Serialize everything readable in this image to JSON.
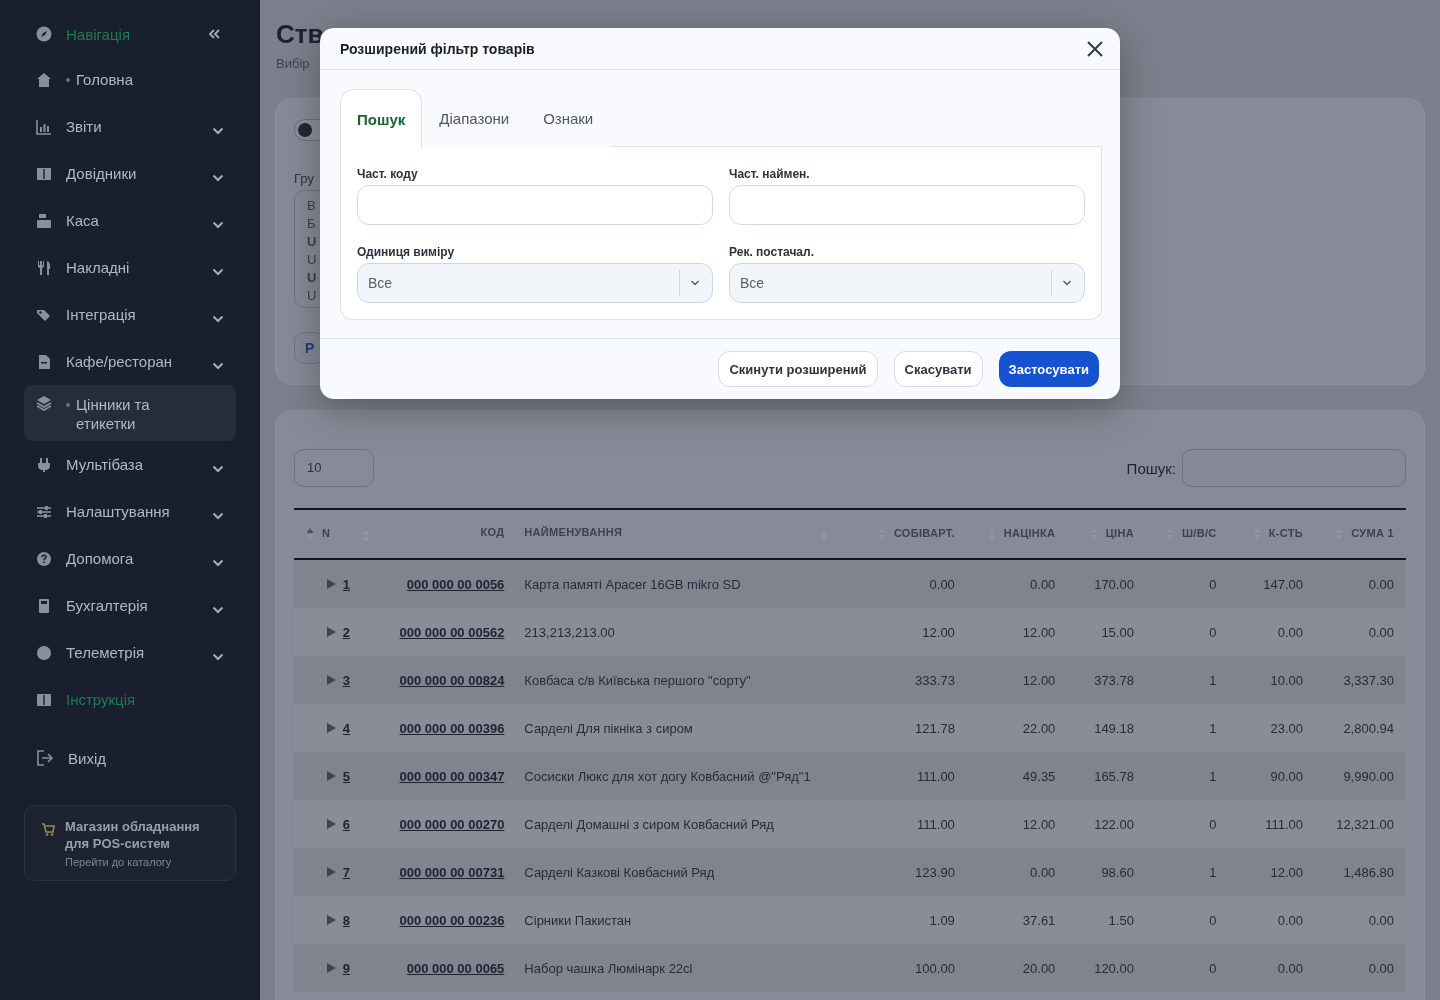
{
  "sidebar": {
    "header": {
      "label": "Навігація"
    },
    "items": [
      {
        "label": "Головна",
        "kind": "link",
        "dot": true,
        "selected": false
      },
      {
        "label": "Звіти",
        "kind": "group",
        "dot": false,
        "selected": false
      },
      {
        "label": "Довідники",
        "kind": "group",
        "dot": false,
        "selected": false
      },
      {
        "label": "Каса",
        "kind": "group",
        "dot": false,
        "selected": false
      },
      {
        "label": "Накладні",
        "kind": "group",
        "dot": false,
        "selected": false
      },
      {
        "label": "Інтеграція",
        "kind": "group",
        "dot": false,
        "selected": false
      },
      {
        "label": "Кафе/ресторан",
        "kind": "group",
        "dot": false,
        "selected": false
      },
      {
        "label": "Цінники та етикетки",
        "kind": "link",
        "dot": true,
        "selected": true
      },
      {
        "label": "Мультібаза",
        "kind": "group",
        "dot": false,
        "selected": false
      },
      {
        "label": "Налаштування",
        "kind": "group",
        "dot": false,
        "selected": false
      },
      {
        "label": "Допомога",
        "kind": "group",
        "dot": false,
        "selected": false
      },
      {
        "label": "Бухгалтерія",
        "kind": "group",
        "dot": false,
        "selected": false
      },
      {
        "label": "Телеметрія",
        "kind": "group",
        "dot": false,
        "selected": false
      },
      {
        "label": "Інструкція",
        "kind": "accent",
        "dot": false,
        "selected": false
      }
    ],
    "logout": {
      "label": "Вихід"
    },
    "promo": {
      "title": "Магазин обладнання для POS-систем",
      "link": "Перейти до каталогу"
    }
  },
  "page": {
    "title": "Ств",
    "subtitle": "Вибір",
    "filter_card": {
      "toggle": {
        "on": false
      },
      "group_label": "Гру",
      "group_list": [
        {
          "text": "В",
          "bold": false
        },
        {
          "text": "Б",
          "bold": false
        },
        {
          "text": "U",
          "bold": true
        },
        {
          "text": "U",
          "bold": false
        },
        {
          "text": "U",
          "bold": true
        },
        {
          "text": "U",
          "bold": false
        }
      ],
      "button": "Р"
    }
  },
  "table_card": {
    "page_length": "10",
    "search_label": "Пошук:",
    "columns": [
      {
        "label": "N",
        "sorted": true
      },
      {
        "label": "КОД",
        "sorted": false
      },
      {
        "label": "НАЙМЕНУВАННЯ",
        "sorted": false
      },
      {
        "label": "СОБІВАРТ.",
        "sorted": false
      },
      {
        "label": "НАЦІНКА",
        "sorted": false
      },
      {
        "label": "ЦІНА",
        "sorted": false
      },
      {
        "label": "Ш/В/С",
        "sorted": false
      },
      {
        "label": "К-СТЬ",
        "sorted": false
      },
      {
        "label": "СУМА 1",
        "sorted": false
      }
    ],
    "rows": [
      [
        "1",
        "000 000 00 0056",
        "Карта памяті Apacer 16GB mikro SD",
        "0.00",
        "0.00",
        "170.00",
        "0",
        "147.00",
        "0.00"
      ],
      [
        "2",
        "000 000 00 00562",
        "213,213,213.00",
        "12.00",
        "12.00",
        "15.00",
        "0",
        "0.00",
        "0.00"
      ],
      [
        "3",
        "000 000 00 00824",
        "Ковбаса с/в Київська першого \"сорту\"",
        "333.73",
        "12.00",
        "373.78",
        "1",
        "10.00",
        "3,337.30"
      ],
      [
        "4",
        "000 000 00 00396",
        "Сарделі Для пікніка з сиром",
        "121.78",
        "22.00",
        "149.18",
        "1",
        "23.00",
        "2,800.94"
      ],
      [
        "5",
        "000 000 00 00347",
        "Сосиски Люкс для хот догу Ковбасний @\"Ряд\"1",
        "111.00",
        "49.35",
        "165.78",
        "1",
        "90.00",
        "9,990.00"
      ],
      [
        "6",
        "000 000 00 00270",
        "Сарделі Домашні з сиром Ковбасний Ряд",
        "111.00",
        "12.00",
        "122.00",
        "0",
        "111.00",
        "12,321.00"
      ],
      [
        "7",
        "000 000 00 00731",
        "Сарделі Казкові Ковбасний Ряд",
        "123.90",
        "0.00",
        "98.60",
        "1",
        "12.00",
        "1,486.80"
      ],
      [
        "8",
        "000 000 00 00236",
        "Сірники Пакистан",
        "1.09",
        "37.61",
        "1.50",
        "0",
        "0.00",
        "0.00"
      ],
      [
        "9",
        "000 000 00 0065",
        "Набор чашка Люмінарк 22cl",
        "100.00",
        "20.00",
        "120.00",
        "0",
        "0.00",
        "0.00"
      ]
    ]
  },
  "modal": {
    "title": "Розширений фільтр товарів",
    "tabs": [
      {
        "label": "Пошук",
        "selected": true
      },
      {
        "label": "Діапазони",
        "selected": false
      },
      {
        "label": "Ознаки",
        "selected": false
      }
    ],
    "fields": [
      {
        "label": "Част. коду",
        "kind": "text"
      },
      {
        "label": "Част. наймен.",
        "kind": "text"
      },
      {
        "label": "Одиниця виміру",
        "kind": "select",
        "value": "Все"
      },
      {
        "label": "Рек. постачал.",
        "kind": "select",
        "value": "Все"
      }
    ],
    "buttons": [
      {
        "label": "Скинути розширений",
        "kind": "outline"
      },
      {
        "label": "Скасувати",
        "kind": "outline"
      },
      {
        "label": "Застосувати",
        "kind": "primary"
      }
    ]
  }
}
